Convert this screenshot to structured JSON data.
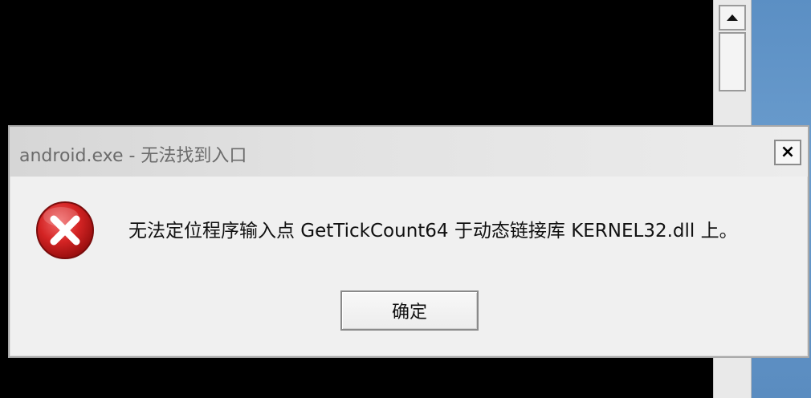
{
  "dialog": {
    "title": "android.exe - 无法找到入口",
    "message": "无法定位程序输入点 GetTickCount64 于动态链接库 KERNEL32.dll 上。",
    "ok_label": "确定",
    "close_label": "×",
    "icon": "error-icon"
  },
  "colors": {
    "error_red": "#cc1f1f",
    "desktop_blue": "#5b8fc4",
    "dialog_bg": "#f0f0f0"
  }
}
